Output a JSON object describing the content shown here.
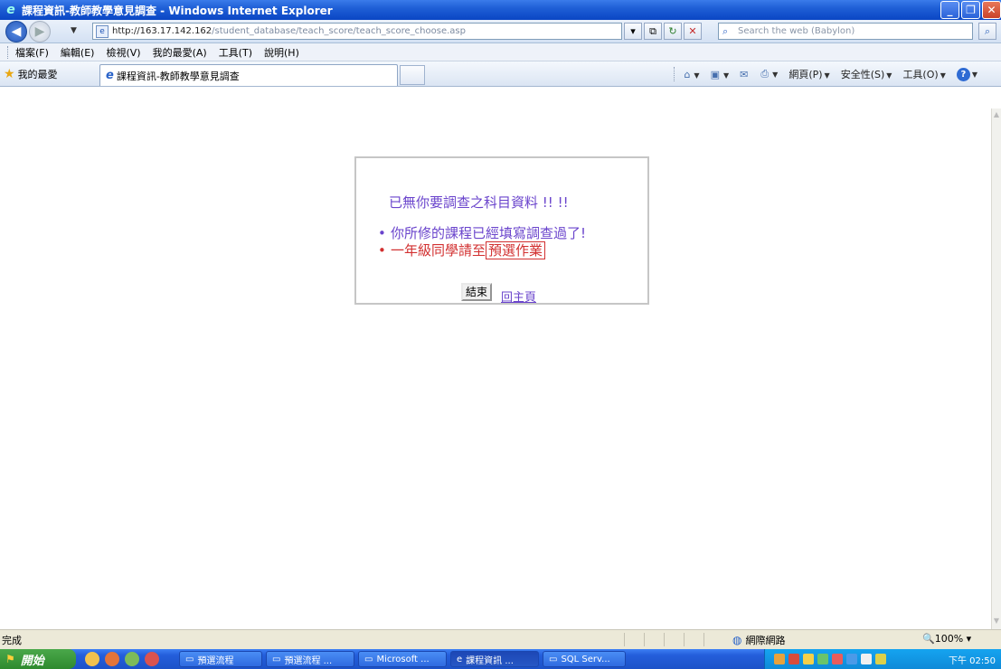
{
  "window": {
    "title": "課程資訊-教師教學意見調查 - Windows Internet Explorer"
  },
  "address": {
    "url_host": "http://163.17.142.162",
    "url_path": "/student_database/teach_score/teach_score_choose.asp",
    "search_placeholder": "Search the web (Babylon)"
  },
  "menu": {
    "items": [
      "檔案(F)",
      "編輯(E)",
      "檢視(V)",
      "我的最愛(A)",
      "工具(T)",
      "說明(H)"
    ]
  },
  "favorites": {
    "label": "我的最愛",
    "tab_title": "課程資訊-教師教學意見調查"
  },
  "command_bar": {
    "page": "網頁(P)",
    "safety": "安全性(S)",
    "tools": "工具(O)"
  },
  "page": {
    "message": "已無你要調查之科目資料 !! !!",
    "bullet1": "你所修的課程已經填寫調查過了!",
    "bullet2_prefix": "一年級同學請至",
    "bullet2_link": "預選作業",
    "end_button": "結束",
    "home_link": "回主頁"
  },
  "status": {
    "text": "完成",
    "zone": "網際網路",
    "zoom": "100%"
  },
  "taskbar": {
    "start": "開始",
    "tasks": [
      "預選流程",
      "預選流程 ...",
      "Microsoft ...",
      "課程資訊 ...",
      "SQL Serv..."
    ],
    "clock": "下午 02:50"
  },
  "colors": {
    "message_purple": "#6a44cc",
    "warning_red": "#d23030",
    "xp_blue": "#245edb"
  }
}
